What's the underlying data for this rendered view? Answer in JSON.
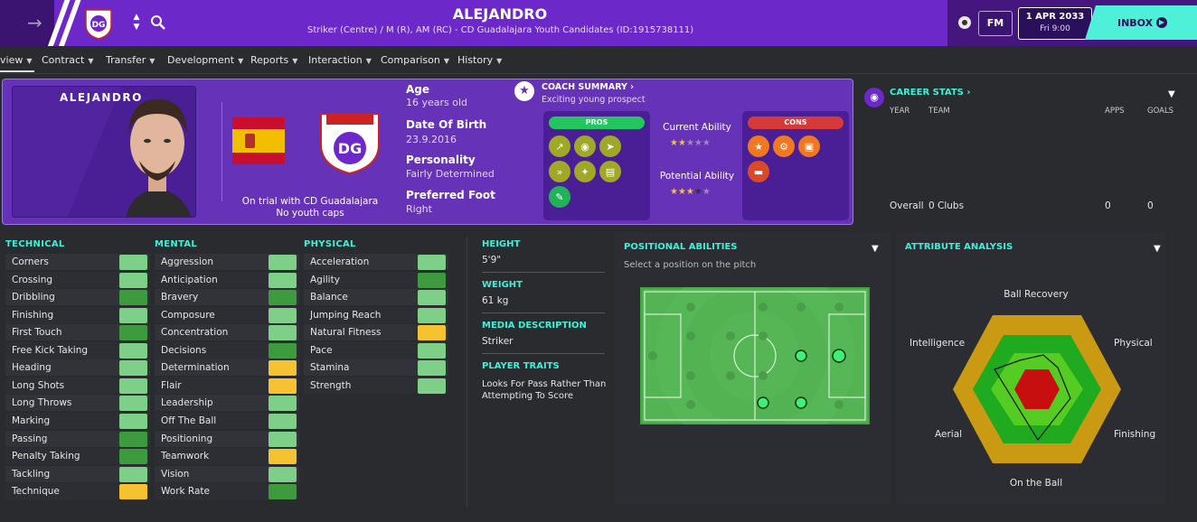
{
  "header": {
    "player_name": "ALEJANDRO",
    "subtitle": "Striker (Centre) / M (R), AM (RC) - CD Guadalajara Youth Candidates (ID:1915738111)",
    "fm_badge": "FM",
    "date": "1 APR 2033",
    "time": "Fri 9:00",
    "inbox_label": "INBOX",
    "accent_color": "#6c28c8",
    "inbox_color": "#4ff0d8"
  },
  "nav": {
    "items": [
      "view",
      "Contract",
      "Transfer",
      "Development",
      "Reports",
      "Interaction",
      "Comparison",
      "History"
    ]
  },
  "card": {
    "portrait_name": "ALEJANDRO",
    "trial_text": "On trial with CD Guadalajara",
    "youth_caps": "No youth caps",
    "age_label": "Age",
    "age_value": "16 years old",
    "dob_label": "Date Of Birth",
    "dob_value": "23.9.2016",
    "personality_label": "Personality",
    "personality_value": "Fairly Determined",
    "foot_label": "Preferred Foot",
    "foot_value": "Right",
    "coach_summary_label": "COACH SUMMARY",
    "coach_summary_text": "Exciting young prospect",
    "pros_label": "PROS",
    "cons_label": "CONS",
    "current_ability_label": "Current Ability",
    "potential_ability_label": "Potential Ability",
    "current_ability_stars": 1.5,
    "potential_ability_stars": 3.5
  },
  "career": {
    "title": "CAREER STATS",
    "columns": [
      "YEAR",
      "TEAM",
      "APPS",
      "GOALS"
    ],
    "overall_label": "Overall",
    "clubs": "0 Clubs",
    "apps": "0",
    "goals": "0"
  },
  "attributes": {
    "technical_title": "TECHNICAL",
    "mental_title": "MENTAL",
    "physical_title": "PHYSICAL",
    "technical": [
      {
        "name": "Corners",
        "level": "g1"
      },
      {
        "name": "Crossing",
        "level": "g1"
      },
      {
        "name": "Dribbling",
        "level": "g2"
      },
      {
        "name": "Finishing",
        "level": "g1"
      },
      {
        "name": "First Touch",
        "level": "g2"
      },
      {
        "name": "Free Kick Taking",
        "level": "g1"
      },
      {
        "name": "Heading",
        "level": "g1"
      },
      {
        "name": "Long Shots",
        "level": "g1"
      },
      {
        "name": "Long Throws",
        "level": "g1"
      },
      {
        "name": "Marking",
        "level": "g1"
      },
      {
        "name": "Passing",
        "level": "g2"
      },
      {
        "name": "Penalty Taking",
        "level": "g2"
      },
      {
        "name": "Tackling",
        "level": "g1"
      },
      {
        "name": "Technique",
        "level": "y"
      }
    ],
    "mental": [
      {
        "name": "Aggression",
        "level": "g1"
      },
      {
        "name": "Anticipation",
        "level": "g1"
      },
      {
        "name": "Bravery",
        "level": "g2"
      },
      {
        "name": "Composure",
        "level": "g1"
      },
      {
        "name": "Concentration",
        "level": "g1"
      },
      {
        "name": "Decisions",
        "level": "g2"
      },
      {
        "name": "Determination",
        "level": "y"
      },
      {
        "name": "Flair",
        "level": "y"
      },
      {
        "name": "Leadership",
        "level": "g1"
      },
      {
        "name": "Off The Ball",
        "level": "g1"
      },
      {
        "name": "Positioning",
        "level": "g1"
      },
      {
        "name": "Teamwork",
        "level": "y"
      },
      {
        "name": "Vision",
        "level": "g1"
      },
      {
        "name": "Work Rate",
        "level": "g2"
      }
    ],
    "physical": [
      {
        "name": "Acceleration",
        "level": "g1"
      },
      {
        "name": "Agility",
        "level": "g2"
      },
      {
        "name": "Balance",
        "level": "g1"
      },
      {
        "name": "Jumping Reach",
        "level": "g1"
      },
      {
        "name": "Natural Fitness",
        "level": "y"
      },
      {
        "name": "Pace",
        "level": "g1"
      },
      {
        "name": "Stamina",
        "level": "g1"
      },
      {
        "name": "Strength",
        "level": "g1"
      }
    ]
  },
  "info": {
    "height_label": "HEIGHT",
    "height_value": "5'9\"",
    "weight_label": "WEIGHT",
    "weight_value": "61 kg",
    "media_label": "MEDIA DESCRIPTION",
    "media_value": "Striker",
    "traits_label": "PLAYER TRAITS",
    "traits_value": "Looks For Pass Rather Than Attempting To Score"
  },
  "positional": {
    "title": "POSITIONAL ABILITIES",
    "hint": "Select a position on the pitch"
  },
  "analysis": {
    "title": "ATTRIBUTE ANALYSIS",
    "labels": [
      "Ball Recovery",
      "Physical",
      "Finishing",
      "On the Ball",
      "Aerial",
      "Intelligence"
    ]
  }
}
